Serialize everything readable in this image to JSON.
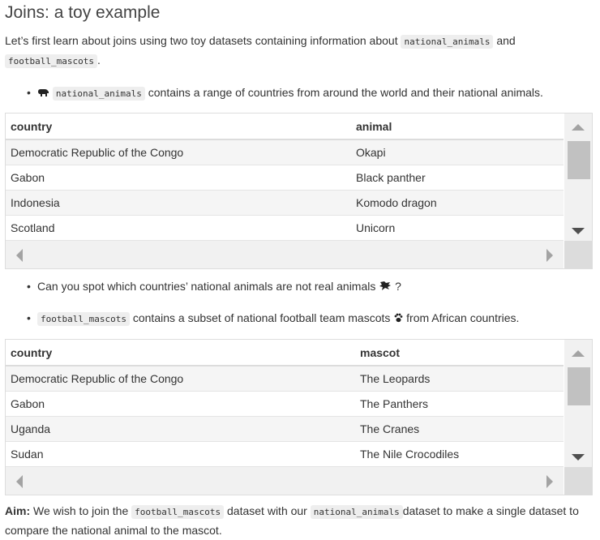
{
  "title": "Joins: a toy example",
  "intro": {
    "text_before": "Let’s first learn about joins using two toy datasets containing information about ",
    "code_1": "national_animals",
    "text_mid": " and",
    "code_2": "football_mascots",
    "text_end": "."
  },
  "bullet1": {
    "icon": "hippo-icon",
    "code": "national_animals",
    "text": " contains a range of countries from around the world and their national animals."
  },
  "table1": {
    "headers": [
      "country",
      "animal"
    ],
    "rows": [
      [
        "Democratic Republic of the Congo",
        "Okapi"
      ],
      [
        "Gabon",
        "Black panther"
      ],
      [
        "Indonesia",
        "Komodo dragon"
      ],
      [
        "Scotland",
        "Unicorn"
      ]
    ]
  },
  "bullet2": {
    "text": "Can you spot which countries’ national animals are not real animals",
    "icon": "dragon-icon",
    "text_end": " ?"
  },
  "bullet3": {
    "code": "football_mascots",
    "text": " contains a subset of national football team mascots ",
    "icon": "paw-icon",
    "text_end": " from African countries."
  },
  "table2": {
    "headers": [
      "country",
      "mascot"
    ],
    "rows": [
      [
        "Democratic Republic of the Congo",
        "The Leopards"
      ],
      [
        "Gabon",
        "The Panthers"
      ],
      [
        "Uganda",
        "The Cranes"
      ],
      [
        "Sudan",
        "The Nile Crocodiles"
      ]
    ]
  },
  "aim": {
    "label": "Aim:",
    "text_1": " We wish to join the ",
    "code_1": "football_mascots",
    "text_2": " dataset with our ",
    "code_2": "national_animals",
    "text_3": "dataset to make a single dataset to compare the national animal to the mascot."
  }
}
